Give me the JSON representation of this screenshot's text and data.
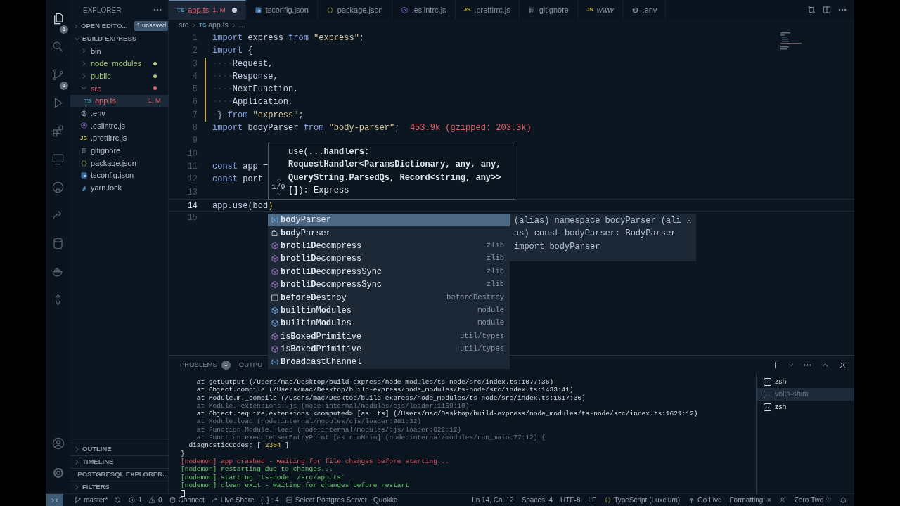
{
  "activity_bar": {
    "items": [
      {
        "kind": "files",
        "selected": true,
        "badge": "1"
      },
      {
        "kind": "search",
        "selected": false
      },
      {
        "kind": "scm",
        "selected": false,
        "badge": "1"
      },
      {
        "kind": "debug",
        "selected": false
      },
      {
        "kind": "extensions",
        "selected": false
      },
      {
        "kind": "remote",
        "selected": false
      },
      {
        "kind": "circle",
        "selected": false
      },
      {
        "kind": "share",
        "selected": false
      },
      {
        "kind": "database",
        "selected": false
      },
      {
        "kind": "whale",
        "selected": false
      },
      {
        "kind": "leaf",
        "selected": false
      }
    ],
    "bottom": [
      {
        "kind": "account"
      },
      {
        "kind": "gear"
      }
    ]
  },
  "sidebar": {
    "title": "EXPLORER",
    "open_editors": {
      "title": "OPEN EDITO...",
      "expanded": false,
      "badge": "1 unsaved"
    },
    "folder": {
      "title": "BUILD-EXPRESS",
      "expanded": true,
      "tree": [
        {
          "label": "bin",
          "kind": "folder",
          "expanded": false,
          "selected": false
        },
        {
          "label": "node_modules",
          "kind": "folder",
          "expanded": false,
          "selected": false,
          "color": "#a8c97f"
        },
        {
          "label": "public",
          "kind": "folder",
          "expanded": false,
          "selected": false,
          "color": "#a8c97f"
        },
        {
          "label": "src",
          "kind": "folder",
          "expanded": true,
          "selected": false,
          "color": "#e0606a",
          "children": [
            {
              "label": "app.ts",
              "kind": "typescript",
              "icon_label": "TS",
              "selected": true,
              "color": "#e0606a",
              "badge": "1, M"
            }
          ]
        },
        {
          "label": ".env",
          "kind": "env",
          "selected": false
        },
        {
          "label": ".eslintrc.js",
          "kind": "eslint",
          "selected": false
        },
        {
          "label": ".prettirrc.js",
          "kind": "javascript",
          "icon_label": "JS",
          "selected": false
        },
        {
          "label": "gitignore",
          "kind": "text",
          "selected": false
        },
        {
          "label": "package.json",
          "kind": "json",
          "selected": false
        },
        {
          "label": "tsconfig.json",
          "kind": "tsconfig",
          "selected": false
        },
        {
          "label": "yarn.lock",
          "kind": "yarn",
          "selected": false
        }
      ]
    },
    "sections": [
      {
        "title": "OUTLINE",
        "expanded": false
      },
      {
        "title": "TIMELINE",
        "expanded": false
      },
      {
        "title": "POSTGRESQL EXPLORER...",
        "expanded": false
      },
      {
        "title": "FILTERS",
        "expanded": false
      }
    ]
  },
  "tabs": [
    {
      "label": "app.ts",
      "kind": "typescript",
      "icon_label": "TS",
      "selected": true,
      "preview": false,
      "modified": true,
      "badge": "1, M",
      "color": "#e0606a"
    },
    {
      "label": "tsconfig.json",
      "kind": "tsconfig",
      "selected": false,
      "preview": false,
      "modified": false
    },
    {
      "label": "package.json",
      "kind": "json",
      "selected": false,
      "preview": false,
      "modified": false
    },
    {
      "label": ".eslintrc.js",
      "kind": "eslint",
      "selected": false,
      "preview": false,
      "modified": false
    },
    {
      "label": ".prettirrc.js",
      "kind": "javascript",
      "icon_label": "JS",
      "selected": false,
      "preview": false,
      "modified": false
    },
    {
      "label": "gitignore",
      "kind": "text",
      "selected": false,
      "preview": false,
      "modified": false
    },
    {
      "label": "www",
      "kind": "javascript",
      "icon_label": "JS",
      "selected": false,
      "preview": true,
      "modified": false
    },
    {
      "label": ".env",
      "kind": "env",
      "selected": false,
      "preview": false,
      "modified": false
    }
  ],
  "breadcrumb": [
    {
      "label": "src"
    },
    {
      "label": "app.ts",
      "kind": "typescript",
      "icon_label": "TS"
    },
    {
      "label": "..."
    }
  ],
  "code": {
    "lines": [
      {
        "number": "1",
        "current": false,
        "changed": false,
        "tokens": [
          {
            "text": "import",
            "kind": "keyword"
          },
          {
            "text": " express ",
            "kind": "ident"
          },
          {
            "text": "from",
            "kind": "keyword"
          },
          {
            "text": " \"express\"",
            "kind": "string"
          },
          {
            "text": ";",
            "kind": "punct"
          }
        ]
      },
      {
        "number": "2",
        "current": false,
        "changed": false,
        "tokens": [
          {
            "text": "import",
            "kind": "keyword"
          },
          {
            "text": " {",
            "kind": "punct"
          }
        ]
      },
      {
        "number": "3",
        "current": false,
        "changed": true,
        "tokens": [
          {
            "text": "····",
            "kind": "ws"
          },
          {
            "text": "Request,",
            "kind": "ident"
          }
        ]
      },
      {
        "number": "4",
        "current": false,
        "changed": true,
        "tokens": [
          {
            "text": "····",
            "kind": "ws"
          },
          {
            "text": "Response,",
            "kind": "ident"
          }
        ]
      },
      {
        "number": "5",
        "current": false,
        "changed": true,
        "tokens": [
          {
            "text": "····",
            "kind": "ws"
          },
          {
            "text": "NextFunction,",
            "kind": "ident"
          }
        ]
      },
      {
        "number": "6",
        "current": false,
        "changed": true,
        "tokens": [
          {
            "text": "····",
            "kind": "ws"
          },
          {
            "text": "Application,",
            "kind": "ident"
          }
        ]
      },
      {
        "number": "7",
        "current": false,
        "changed": true,
        "tokens": [
          {
            "text": "·",
            "kind": "ws"
          },
          {
            "text": "} ",
            "kind": "punct"
          },
          {
            "text": "from",
            "kind": "keyword"
          },
          {
            "text": " \"express\"",
            "kind": "string"
          },
          {
            "text": ";",
            "kind": "punct"
          }
        ]
      },
      {
        "number": "8",
        "current": false,
        "changed": false,
        "tokens": [
          {
            "text": "import",
            "kind": "keyword"
          },
          {
            "text": " bodyParser ",
            "kind": "ident"
          },
          {
            "text": "from",
            "kind": "keyword"
          },
          {
            "text": " \"body-parser\"",
            "kind": "string"
          },
          {
            "text": ";",
            "kind": "punct"
          },
          {
            "text": "  453.9k (gzipped: 203.3k)",
            "kind": "cost"
          }
        ]
      },
      {
        "number": "9",
        "current": false,
        "changed": false
      },
      {
        "number": "10",
        "current": false,
        "changed": false
      },
      {
        "number": "11",
        "current": false,
        "changed": false,
        "tokens": [
          {
            "text": "const",
            "kind": "keyword"
          },
          {
            "text": " app =",
            "kind": "ident"
          }
        ]
      },
      {
        "number": "12",
        "current": false,
        "changed": false,
        "tokens": [
          {
            "text": "const",
            "kind": "keyword"
          },
          {
            "text": " port",
            "kind": "ident"
          }
        ]
      },
      {
        "number": "13",
        "current": false,
        "changed": false
      },
      {
        "number": "14",
        "current": true,
        "changed": false,
        "tokens": [
          {
            "text": "app.use(bod",
            "kind": "ident"
          },
          {
            "text": ")",
            "kind": "bracket"
          }
        ]
      },
      {
        "number": "15",
        "current": false,
        "changed": false
      }
    ]
  },
  "signature_help": {
    "counter": "1/9",
    "lines": [
      "use(**...handlers:**",
      "**RequestHandler<ParamsDictionary, any, any,**",
      "**QueryString.ParsedQs, Record<string, any>>**",
      "**[]**): Express"
    ]
  },
  "suggestions": [
    {
      "label": "**bod**yParser",
      "kind": "variable",
      "selected": true
    },
    {
      "label": "**bod**yParser",
      "kind": "module",
      "selected": false
    },
    {
      "label": "**b**r**o**tli**D**ecompress",
      "kind": "method",
      "detail": "zlib",
      "selected": false
    },
    {
      "label": "**b**r**o**tli**D**ecompress",
      "kind": "method",
      "detail": "zlib",
      "selected": false
    },
    {
      "label": "**b**r**o**tli**D**ecompressSync",
      "kind": "method",
      "detail": "zlib",
      "selected": false
    },
    {
      "label": "**b**r**o**tli**D**ecompressSync",
      "kind": "method",
      "detail": "zlib",
      "selected": false
    },
    {
      "label": "**b**ef**o**re**D**estroy",
      "kind": "word",
      "detail": "beforeDestroy",
      "selected": false
    },
    {
      "label": "**b**uiltinM**od**ules",
      "kind": "property",
      "detail": "module",
      "selected": false
    },
    {
      "label": "**b**uiltinM**od**ules",
      "kind": "property",
      "detail": "module",
      "selected": false
    },
    {
      "label": "is**Bo**xe**d**Primitive",
      "kind": "method",
      "detail": "util/types",
      "selected": false
    },
    {
      "label": "is**Bo**xe**d**Primitive",
      "kind": "method",
      "detail": "util/types",
      "selected": false
    },
    {
      "label": "**B**r**o**a**d**castChannel",
      "kind": "variable",
      "selected": false
    }
  ],
  "suggestion_detail": {
    "lines": [
      "(alias) namespace bodyParser (ali",
      "as) const bodyParser: BodyParser",
      "import bodyParser"
    ]
  },
  "panel": {
    "tabs": [
      {
        "label": "PROBLEMS",
        "badge": "1",
        "selected": false
      },
      {
        "label": "OUTPU",
        "selected": false
      }
    ],
    "terminal": [
      {
        "text": "    at getOutput (/Users/mac/Desktop/build-express/node_modules/ts-node/src/index.ts:1077:36)",
        "kind": "normal"
      },
      {
        "text": "    at Object.compile (/Users/mac/Desktop/build-express/node_modules/ts-node/src/index.ts:1433:41)",
        "kind": "normal"
      },
      {
        "text": "    at Module.m._compile (/Users/mac/Desktop/build-express/node_modules/ts-node/src/index.ts:1617:30)",
        "kind": "normal"
      },
      {
        "text": "    at Module._extensions..js (node:internal/modules/cjs/loader:1159:10)",
        "kind": "dim"
      },
      {
        "text": "    at Object.require.extensions.<computed> [as .ts] (/Users/mac/Desktop/build-express/node_modules/ts-node/src/index.ts:1621:12)",
        "kind": "normal"
      },
      {
        "text": "    at Module.load (node:internal/modules/cjs/loader:981:32)",
        "kind": "dim"
      },
      {
        "text": "    at Function.Module._load (node:internal/modules/cjs/loader:822:12)",
        "kind": "dim"
      },
      {
        "text": "    at Function.executeUserEntryPoint [as runMain] (node:internal/modules/run_main:77:12) {",
        "kind": "dim"
      },
      {
        "kind": "normal",
        "segments": [
          {
            "text": "  diagnosticCodes: [ ",
            "kind": "normal"
          },
          {
            "text": "2304",
            "kind": "number"
          },
          {
            "text": " ]",
            "kind": "normal"
          }
        ]
      },
      {
        "text": "}",
        "kind": "normal"
      },
      {
        "text": "[nodemon] app crashed - waiting for file changes before starting...",
        "kind": "error"
      },
      {
        "text": "[nodemon] restarting due to changes...",
        "kind": "success"
      },
      {
        "text": "[nodemon] starting `ts-node ./src/app.ts`",
        "kind": "success"
      },
      {
        "text": "[nodemon] clean exit - waiting for changes before restart",
        "kind": "success"
      }
    ],
    "terminals": [
      {
        "label": "zsh",
        "selected": false
      },
      {
        "label": "volta-shim",
        "selected": true
      },
      {
        "label": "zsh",
        "selected": false
      }
    ]
  },
  "status_bar": {
    "left": [
      {
        "kind": "remote"
      },
      {
        "kind": "branch",
        "text": "master*"
      },
      {
        "kind": "sync"
      },
      {
        "kind": "error",
        "text": "1"
      },
      {
        "kind": "warning",
        "text": "0"
      },
      {
        "kind": "database",
        "text": "Connect"
      },
      {
        "kind": "share",
        "text": "Live Share"
      },
      {
        "kind": "text",
        "text": "{..} : 4"
      },
      {
        "kind": "server",
        "text": "Select Postgres Server"
      },
      {
        "kind": "text",
        "text": "Quokka"
      }
    ],
    "right": [
      {
        "kind": "text",
        "text": "Ln 14, Col 12"
      },
      {
        "kind": "text",
        "text": "Spaces: 4"
      },
      {
        "kind": "text",
        "text": "UTF-8"
      },
      {
        "kind": "text",
        "text": "LF"
      },
      {
        "kind": "json",
        "text": "TypeScript (Luxcium)"
      },
      {
        "kind": "radio",
        "text": "Go Live"
      },
      {
        "kind": "text",
        "text": "Formatting: ×"
      },
      {
        "kind": "feedback"
      },
      {
        "kind": "text",
        "text": "Zero Two ♡"
      },
      {
        "kind": "bell"
      }
    ]
  }
}
